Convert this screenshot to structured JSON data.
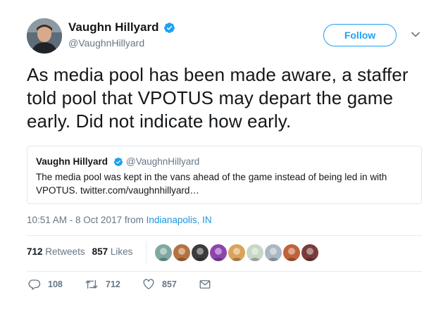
{
  "author": {
    "name": "Vaughn Hillyard",
    "handle": "@VaughnHillyard",
    "verified": true
  },
  "follow_label": "Follow",
  "tweet_text": "As media pool has been made aware, a staffer told pool that VPOTUS may depart the game early. Did not indicate how early.",
  "quoted_tweet": {
    "name": "Vaughn Hillyard",
    "handle": "@VaughnHillyard",
    "text": "The media pool was kept in the vans ahead of the game instead of being led in with VPOTUS. twitter.com/vaughnhillyard…"
  },
  "timestamp": "10:51 AM - 8 Oct 2017 from ",
  "location": "Indianapolis, IN",
  "stats": {
    "retweets_count": "712",
    "retweets_label": "Retweets",
    "likes_count": "857",
    "likes_label": "Likes"
  },
  "liker_avatars": [
    {
      "name": "statue-avatar",
      "color": "#7fa9a0"
    },
    {
      "name": "face-avatar",
      "color": "#b5723f"
    },
    {
      "name": "person-avatar",
      "color": "#3b3b3b"
    },
    {
      "name": "cartoon-avatar",
      "color": "#8e44ad"
    },
    {
      "name": "blonde-avatar",
      "color": "#d9a45a"
    },
    {
      "name": "illustrated-avatar",
      "color": "#c9d8c5"
    },
    {
      "name": "default-avatar",
      "color": "#aab8c2"
    },
    {
      "name": "group-avatar",
      "color": "#c0623a"
    },
    {
      "name": "portrait-avatar",
      "color": "#7a3b3b"
    }
  ],
  "actions": {
    "replies": "108",
    "retweets": "712",
    "likes": "857"
  },
  "colors": {
    "accent": "#1da1f2",
    "secondary_text": "#657786",
    "primary_text": "#14171a",
    "border": "#e1e8ed"
  }
}
